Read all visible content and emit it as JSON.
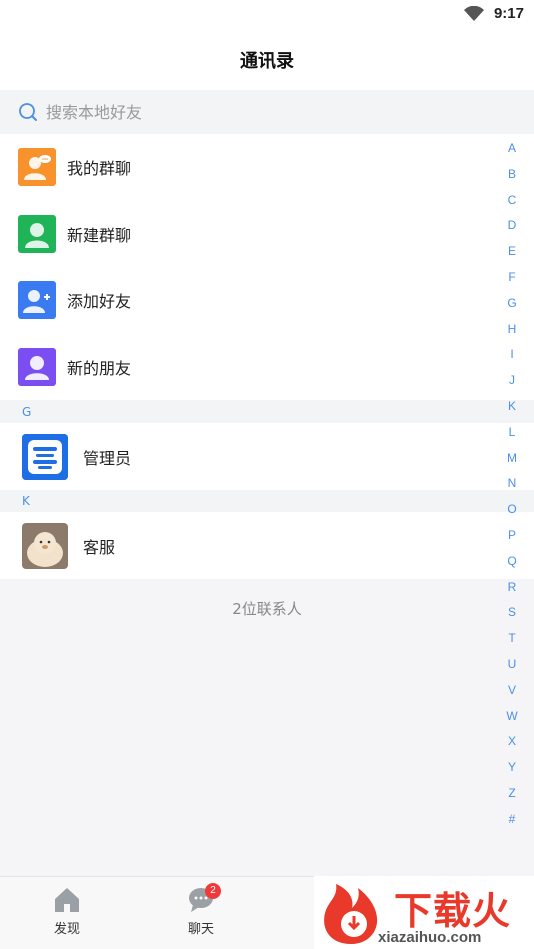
{
  "status_bar": {
    "time": "9:17"
  },
  "header": {
    "title": "通讯录"
  },
  "search": {
    "placeholder": "搜索本地好友"
  },
  "functions": [
    {
      "label": "我的群聊",
      "icon": "my-groups-icon",
      "color": "#f7922d"
    },
    {
      "label": "新建群聊",
      "icon": "new-group-icon",
      "color": "#1fb457"
    },
    {
      "label": "添加好友",
      "icon": "add-friend-icon",
      "color": "#3a7bf2"
    },
    {
      "label": "新的朋友",
      "icon": "new-friends-icon",
      "color": "#7a4ef0"
    }
  ],
  "sections": [
    {
      "letter": "G",
      "contacts": [
        {
          "name": "管理员",
          "avatar": "admin-avatar"
        }
      ]
    },
    {
      "letter": "K",
      "contacts": [
        {
          "name": "客服",
          "avatar": "service-avatar"
        }
      ]
    }
  ],
  "contact_count": "2位联系人",
  "alpha_index": [
    "A",
    "B",
    "C",
    "D",
    "E",
    "F",
    "G",
    "H",
    "I",
    "J",
    "K",
    "L",
    "M",
    "N",
    "O",
    "P",
    "Q",
    "R",
    "S",
    "T",
    "U",
    "V",
    "W",
    "X",
    "Y",
    "Z",
    "#"
  ],
  "tabs": [
    {
      "label": "发现",
      "icon": "home-icon"
    },
    {
      "label": "聊天",
      "icon": "chat-icon",
      "badge": "2"
    }
  ],
  "watermark": {
    "text": "下载火",
    "url": "xiazaihuo.com"
  },
  "colors": {
    "accent": "#4a8fe8",
    "badge": "#f03a3a",
    "watermark": "#e8392b"
  }
}
